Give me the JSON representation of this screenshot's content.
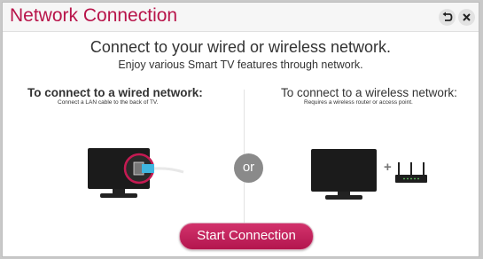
{
  "window": {
    "title": "Network Connection"
  },
  "header": {
    "back_icon": "back-arrow-icon",
    "close_icon": "close-icon"
  },
  "main": {
    "heading": "Connect to your wired or wireless network.",
    "subheading": "Enjoy various Smart TV features through network."
  },
  "wired": {
    "title": "To connect to a wired network:",
    "subtitle": "Connect a LAN cable to the back of TV."
  },
  "wireless": {
    "title": "To connect to a wireless network:",
    "subtitle": "Requires a wireless router or access point.",
    "plus": "+"
  },
  "separator": {
    "label": "or"
  },
  "footer": {
    "start_label": "Start Connection"
  },
  "colors": {
    "accent": "#b8144a",
    "button": "#c82560"
  }
}
